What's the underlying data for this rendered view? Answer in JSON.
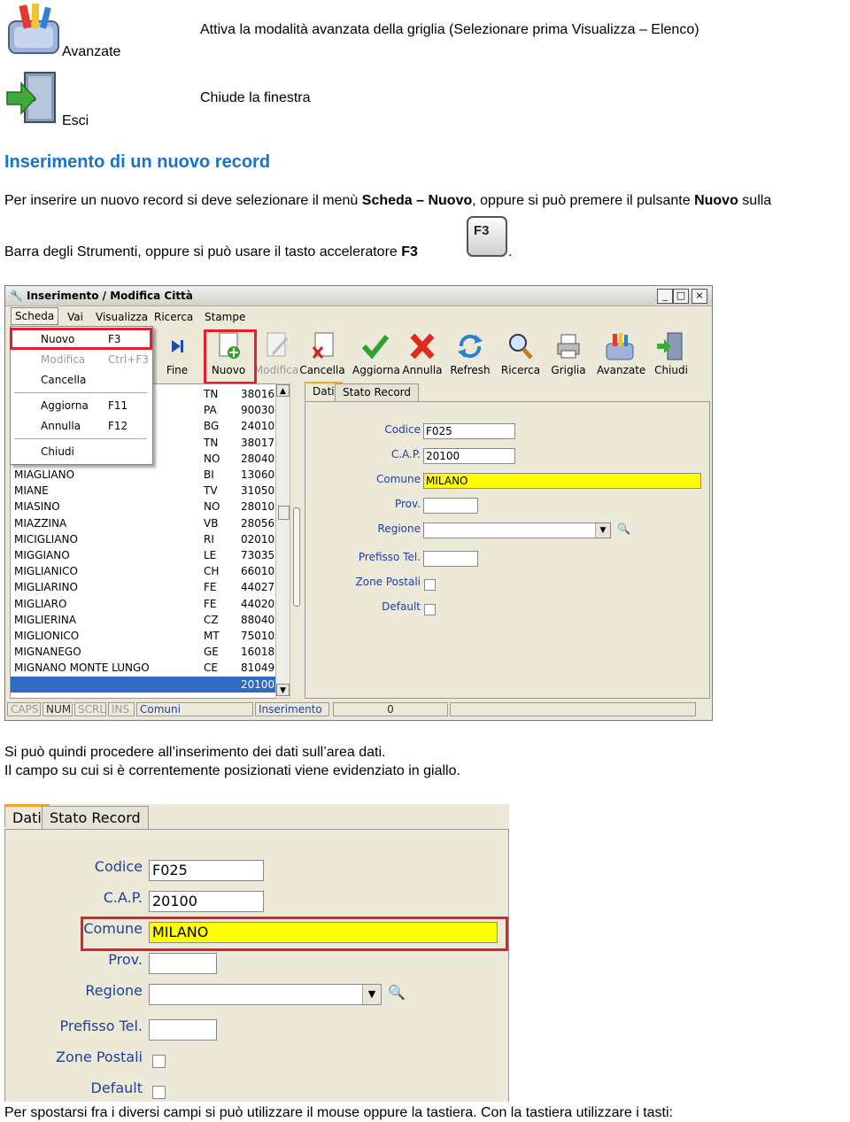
{
  "doc": {
    "avanzate_label": "Avanzate",
    "avanzate_desc": "Attiva la modalità avanzata della griglia (Selezionare prima Visualizza – Elenco)",
    "esci_label": "Esci",
    "esci_desc": "Chiude la finestra",
    "section_title": "Inserimento di un nuovo record",
    "para1": {
      "a": "Per inserire un nuovo record si deve selezionare il menù ",
      "b1": "Scheda – Nuovo",
      "c": ", oppure si può premere il pulsante ",
      "b2": "Nuovo",
      "d": " sulla"
    },
    "para2": {
      "a": "Barra degli Strumenti, oppure si può usare il tasto acceleratore ",
      "b": "F3",
      "key": "F3",
      "end": "."
    },
    "para3_line1": "Si può quindi procedere all’inserimento dei dati sull’area dati.",
    "para3_line2": "Il campo su cui si è correntemente posizionati viene evidenziato in giallo.",
    "para4": "Per spostarsi fra i diversi campi si può utilizzare il mouse oppure la tastiera. Con la tastiera utilizzare i tasti:"
  },
  "window": {
    "title": "Inserimento / Modifica Città",
    "buttons": {
      "minimize": "_",
      "maximize": "□",
      "close": "×"
    },
    "menu": [
      "Scheda",
      "Vai",
      "Visualizza",
      "Ricerca",
      "Stampe"
    ],
    "toolbar": [
      "Fine",
      "Nuovo",
      "Modifica",
      "Cancella",
      "Aggiorna",
      "Annulla",
      "Refresh",
      "Ricerca",
      "Griglia",
      "Avanzate",
      "Chiudi"
    ],
    "dropdown": [
      {
        "label": "Nuovo",
        "shortcut": "F3"
      },
      {
        "label": "Modifica",
        "shortcut": "Ctrl+F3"
      },
      {
        "label": "Cancella",
        "shortcut": ""
      },
      {
        "label": "Aggiorna",
        "shortcut": "F11"
      },
      {
        "label": "Annulla",
        "shortcut": "F12"
      },
      {
        "label": "Chiudi",
        "shortcut": ""
      }
    ],
    "grid_rows": [
      {
        "name": "",
        "prov": "TN",
        "cap": "38016"
      },
      {
        "name": "",
        "prov": "PA",
        "cap": "90030"
      },
      {
        "name": "",
        "prov": "BG",
        "cap": "24010"
      },
      {
        "name": "",
        "prov": "TN",
        "cap": "38017"
      },
      {
        "name": "",
        "prov": "NO",
        "cap": "28040"
      },
      {
        "name": "MIAGLIANO",
        "prov": "BI",
        "cap": "13060"
      },
      {
        "name": "MIANE",
        "prov": "TV",
        "cap": "31050"
      },
      {
        "name": "MIASINO",
        "prov": "NO",
        "cap": "28010"
      },
      {
        "name": "MIAZZINA",
        "prov": "VB",
        "cap": "28056"
      },
      {
        "name": "MICIGLIANO",
        "prov": "RI",
        "cap": "02010"
      },
      {
        "name": "MIGGIANO",
        "prov": "LE",
        "cap": "73035"
      },
      {
        "name": "MIGLIANICO",
        "prov": "CH",
        "cap": "66010"
      },
      {
        "name": "MIGLIARINO",
        "prov": "FE",
        "cap": "44027"
      },
      {
        "name": "MIGLIARO",
        "prov": "FE",
        "cap": "44020"
      },
      {
        "name": "MIGLIERINA",
        "prov": "CZ",
        "cap": "88040"
      },
      {
        "name": "MIGLIONICO",
        "prov": "MT",
        "cap": "75010"
      },
      {
        "name": "MIGNANEGO",
        "prov": "GE",
        "cap": "16018"
      },
      {
        "name": "MIGNANO MONTE LUNGO",
        "prov": "CE",
        "cap": "81049"
      },
      {
        "name": "",
        "prov": "",
        "cap": "20100"
      }
    ],
    "tabs": [
      "Dati",
      "Stato Record"
    ],
    "form": {
      "codice_label": "Codice",
      "codice_value": "F025",
      "cap_label": "C.A.P.",
      "cap_value": "20100",
      "comune_label": "Comune",
      "comune_value": "MILANO",
      "prov_label": "Prov.",
      "regione_label": "Regione",
      "prefisso_label": "Prefisso Tel.",
      "zone_label": "Zone Postali",
      "default_label": "Default"
    },
    "status": [
      "CAPS",
      "NUM",
      "SCRL",
      "INS",
      "Comuni",
      "Inserimento",
      "0"
    ]
  },
  "colors": {
    "heading": "#1a73c8",
    "highlight": "#e0202a",
    "field_focus": "#ffff00",
    "label": "#1f3fa0"
  }
}
